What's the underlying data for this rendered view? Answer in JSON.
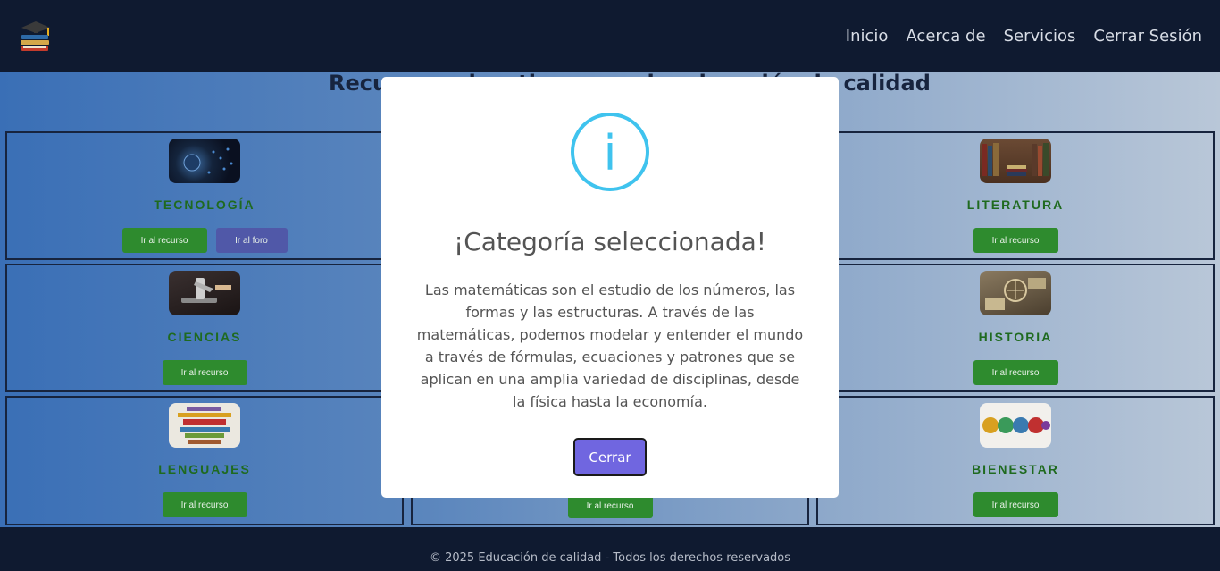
{
  "nav": {
    "links": [
      "Inicio",
      "Acerca de",
      "Servicios",
      "Cerrar Sesión"
    ]
  },
  "page": {
    "title": "Recursos educativos para la educación de calidad"
  },
  "categories": [
    {
      "title": "TECNOLOGÍA",
      "buttons": [
        "Ir al recurso",
        "Ir al foro"
      ]
    },
    {
      "title": "",
      "buttons": []
    },
    {
      "title": "LITERATURA",
      "buttons": [
        "Ir al recurso"
      ]
    },
    {
      "title": "CIENCIAS",
      "buttons": [
        "Ir al recurso"
      ]
    },
    {
      "title": "",
      "buttons": []
    },
    {
      "title": "HISTORIA",
      "buttons": [
        "Ir al recurso"
      ]
    },
    {
      "title": "LENGUAJES",
      "buttons": [
        "Ir al recurso"
      ]
    },
    {
      "title": "",
      "buttons": [
        "Ir al recurso"
      ]
    },
    {
      "title": "BIENESTAR",
      "buttons": [
        "Ir al recurso"
      ]
    }
  ],
  "modal": {
    "icon": "i",
    "title": "¡Categoría seleccionada!",
    "text": "Las matemáticas son el estudio de los números, las formas y las estructuras. A través de las matemáticas, podemos modelar y entender el mundo a través de fórmulas, ecuaciones y patrones que se aplican en una amplia variedad de disciplinas, desde la física hasta la economía.",
    "button": "Cerrar"
  },
  "footer": {
    "text": "© 2025 Educación de calidad - Todos los derechos reservados"
  },
  "colors": {
    "nav_bg": "#0f1a30",
    "accent_green": "#2e8b2e",
    "accent_purple": "#5058a8",
    "modal_button": "#7066e0",
    "info_icon": "#3fc3ee"
  },
  "icons": {
    "logo": "books-graduation-cap-icon"
  }
}
